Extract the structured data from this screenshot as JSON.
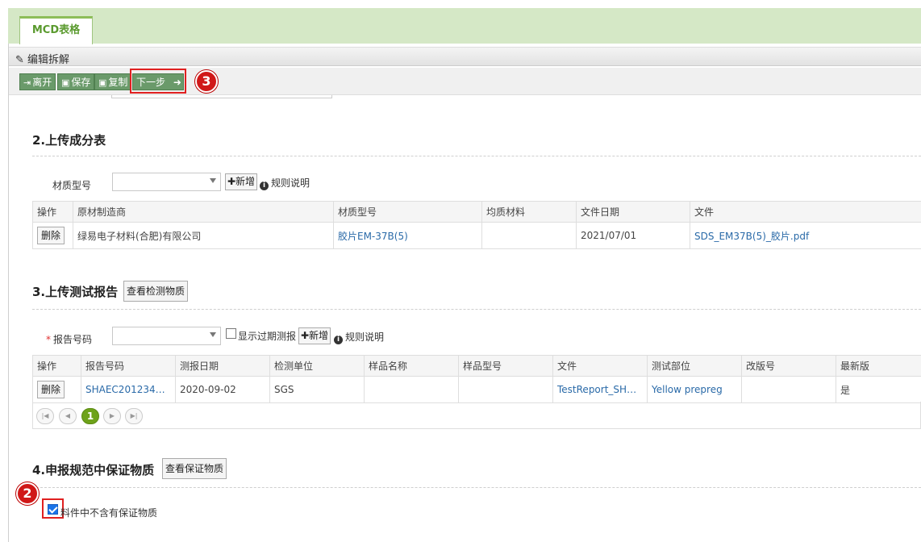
{
  "tab": {
    "label": "MCD表格"
  },
  "panel": {
    "title": "编辑拆解"
  },
  "toolbar": {
    "leave": "离开",
    "save": "保存",
    "copy": "复制",
    "next": "下一步"
  },
  "badges": {
    "next_step": "3",
    "checkbox": "2"
  },
  "section2": {
    "title": "2.上传成分表",
    "field_label": "材质型号",
    "add": "✚新增",
    "rules": "规则说明",
    "columns": [
      "操作",
      "原材制造商",
      "材质型号",
      "均质材料",
      "文件日期",
      "文件"
    ],
    "rows": [
      {
        "action": "删除",
        "manufacturer": "绿易电子材料(合肥)有限公司",
        "material": "胶片EM-37B(5)",
        "homogeneous": "",
        "date": "2021/07/01",
        "file": "SDS_EM37B(5)_胶片.pdf"
      }
    ]
  },
  "section3": {
    "title": "3.上传测试报告",
    "view_btn": "查看检测物质",
    "field_label": "报告号码",
    "required_mark": "*",
    "show_expired": "显示过期测报",
    "add": "✚新增",
    "rules": "规则说明",
    "columns": [
      "操作",
      "报告号码",
      "测报日期",
      "检测单位",
      "样品名称",
      "样品型号",
      "文件",
      "测试部位",
      "改版号",
      "最新版"
    ],
    "rows": [
      {
        "action": "删除",
        "report_no": "SHAEC2012341…",
        "date": "2020-09-02",
        "lab": "SGS",
        "sample_name": "",
        "sample_model": "",
        "file": "TestReport_SHA…",
        "part": "Yellow prepreg",
        "revision": "",
        "latest": "是"
      }
    ],
    "pager": {
      "current": "1"
    }
  },
  "section4": {
    "title": "4.申报规范中保证物质",
    "view_btn": "查看保证物质",
    "checkbox_label": "料件中不含有保证物质",
    "checkbox_checked": true
  }
}
